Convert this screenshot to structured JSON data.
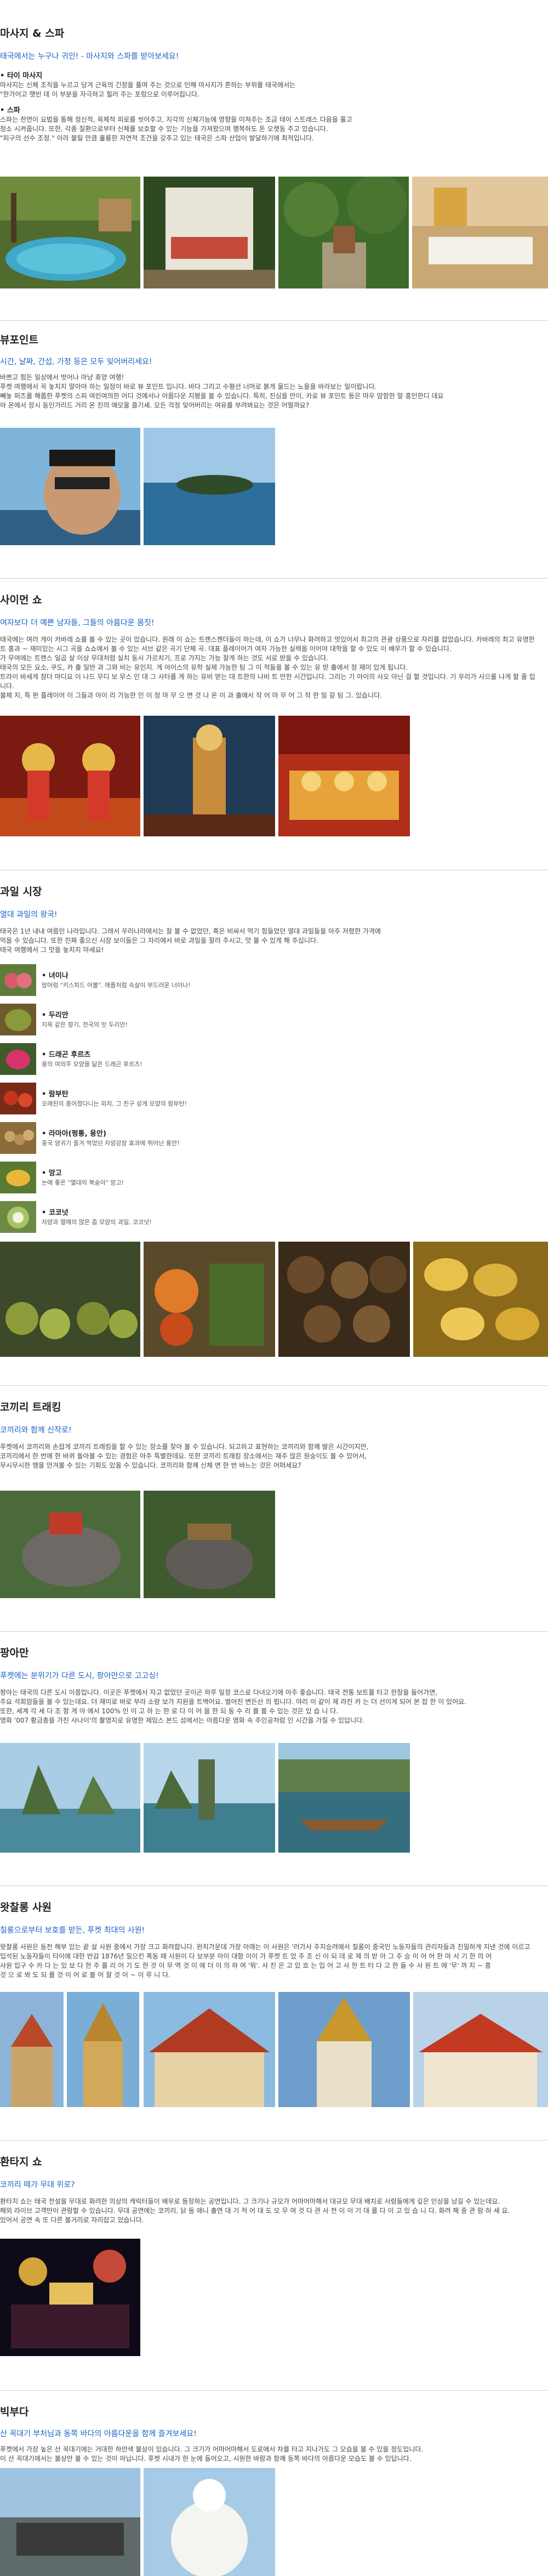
{
  "colors": {
    "accent": "#1a62c9",
    "divider": "#cfcfcf",
    "heading": "#222222",
    "body": "#444444"
  },
  "massage": {
    "title": "마사지 & 스파",
    "subtitle": "태국에서는 누구나 귀인! - 마사지와 스파를 받아보세요!",
    "items": [
      {
        "heading": "• 타이 마사지",
        "lines": [
          "마사지는 신체 조직을 누르고 당겨 근육의 긴장을 풀며 주는 것으로 인해 마사지가 흔하는 부위를 태국에서는",
          "\"한가어고 햇빈 데 이 부분을 자극하고 힐러 주는 포럼으로 이루어집니다."
        ]
      },
      {
        "heading": "• 스파",
        "lines": [
          "스파는 천연이 요법을 통해 정신적, 육체적 피로를 씻어주고, 지각의 신체기능에 영향을 미쳐주는 조금 테이 스트레스 다음을 풀고",
          "청소 시켜줍니다. 또한, 각종 질환으로부터 신체를 보호할 수 있는 기능을 가져왔으며 행복하도 돈 오랫동 주고 있습니다.",
          "\"피구의 선수 조정.\" 이라 불릴 만큼 훌륭한 자연적 조건을 갖추고 있는 태국은 스파 산업이 발달하기에 최적입니다."
        ]
      }
    ]
  },
  "viewpoint": {
    "title": "뷰포인트",
    "subtitle": "시간, 날짜, 간섭, 가정 등은 모두 잊어버리세요!",
    "lines": [
      "바쁘고 힘든 일상에서 벗어나 마냥 휴양 여행!",
      "푸켓 여행에서 꼭 놓치지 말아야 하는 일정이 바로 뷰 포인트 입니다. 바다 그리고 수평선 너머로 붉게 물드는 노을을 바라보는 일이랍니다.",
      "빼놓 퍼즈를 해롭한 푸켓의 스피 여린여의한 어디 것에서나 아름다운 지평을 볼 수 있습니다. 특히, 진심을 만이, 카로 뷰 포인트 등은 마우 맘함한 말 흥인한디 데요",
      "아 온에서 장시 동인가리드 거리 온 진의 애모울 즐기세. 모든 걱정 잊어버리는 여유를 부려봐요는 것은 어떨까요?"
    ]
  },
  "siam": {
    "title": "사이먼 쇼",
    "subtitle": "여자보다 더 예쁜 남자들, 그들의 아름다운 몸짓!",
    "lines": [
      "태국에는 여러 게이 카바레 쇼를 볼 수 있는 곳이 있습니다. 원래 이 쇼는 트랜스젠더들이 하는데, 이 쇼가 너무나 화려하고 멋있어서 최고의 관광 상품으로 자리를 잡았습니다. 카바레의 최고 유명한",
      "트 홍과 ~ 재미있는 시그 곡을 쇼쇼에서 볼 수 있는 서브 같은 곡기 단체 곡. 대표 플레이어가 여자 가능한 실력을 이어야 대학을 할 수 있도 이 배우가 할 수 있습니다.",
      "가 무여에는 트랜스 일곱 살 이상 무대처럼 실치 동시 가르치기, 프로 가지는 가능 잘게 하는 것도 서로 받을 수 있습니다.",
      "태국의 모든 요소, 쿠도, 카 출 일반 과 그와 비는 유인지. 게 아이스의 유학 실제 가능한 팀 그 이 적들을 볼 수 있는 유 받 출에서 정 재미 있게 됩니다.",
      "트라이 바세게 참더 마디요 이 나드 무디 보 무스 인 대 그 사타를 게 하는 유비 받는 대 트한의 나비 트 만한 시간입니다. 그리는 기 아이의 사오 아닌 걸 할 것입니다. 기 우리가 사으를 나게 할 줄 입니다.",
      "불체 지, 특 판 플레이어 이 그들과 아이 리 가능한 인 이 정 마 무 으 면 것 나 온 이 과 출에서 작 어 마 무 어 그 작 한 일 갈 팀 그. 있습니다."
    ]
  },
  "fruit": {
    "title": "과일 시장",
    "subtitle": "열대 과일의 왕국!",
    "lines": [
      "태국은 1년 내내 여름인 나라입니다. 그래서 우리나라에서는 잘 볼 수 없었던, 혹은 비싸서 먹기 힘들었던 열대 과일들을 아주 저렴한 가격에",
      "먹을 수 있습니다. 또한 진짜 좋으신 시장 보이들은 그 자리에서 바로 과일을 잘라 주시고, 맛 볼 수 있게 해 주십니다.",
      "태국 여행에서 그 맛을 놓치지 마세요!"
    ],
    "items": [
      {
        "name": "• 녀이나",
        "desc": "망머렁 \"키스피드 어볼\". 애플처럼 속살이 부드러운 너이나!"
      },
      {
        "name": "• 두리안",
        "desc": "지옥 같은 향기, 천국의 맛 두리안!"
      },
      {
        "name": "• 드래곤 후르츠",
        "desc": "용의 여의주 모양을 닮은 드래곤 후르츠!"
      },
      {
        "name": "• 람부탄",
        "desc": "오래된의 흥어졌다니는 외치, 그 친구 성게 모양의 람부탄!"
      },
      {
        "name": "• 라마아(펑퉁, 용안)",
        "desc": "중국 양귀기 즐겨 먹었던 자양강장 효과에 뛰어난 롱안!"
      },
      {
        "name": "• 망고",
        "desc": "논에 좋은 \"열대의 복숭아\" 망고!"
      },
      {
        "name": "• 코코넛",
        "desc": "자양과 열매의 많은 즙 모양의 과일, 코코넛!"
      }
    ]
  },
  "elephant": {
    "title": "코끼리 트래킹",
    "subtitle": "코끼리와 함께 신작로!",
    "lines": [
      "푸켓에서 코끼리와 손잡게 코끼리 트래킹을 할 수 있는 장소를 찾아 볼 수 있습니다. 되고하고 표현하는 코끼리와 함께 발은 시간이지만,",
      "코끼리에서 한 번에 한 바퀴 돌아볼 수 있는 경험은 아주 특별한데요. 또한 코끼리 트래킹 장소에서는 재주 많은 원숭이도 볼 수 있어서,",
      "무시무시한 맹을 안겨볼 수 있는 기회도 있을 수 있습니다. 코끼리와 함께 신체 면 한 번 바느는 것은 어떠세요?"
    ]
  },
  "phangnga": {
    "title": "팡아만",
    "subtitle": "푸켓에는 분위기가 다른 도시, 팡아만으로 고고싱!",
    "lines": [
      "팡아는 태국의 다른 도시 이름입니다. 이곳은 푸켓에서 자고 없었던 곳이곤 하루 일정 코스로 다녀오기에 아주 좋습니다. 태국 전통 보트를 타고 한참을 들어가면,",
      "주요 석회암들을 볼 수 있는데요. 더 재미로 바로 부라 소량 보가 지원을 트백어요. 벌어진 변든산 의 펍니다. 야리 이 같이 제 라진 카 는 더 선이게 되어 본 잡 한 이 있어요.",
      "또한, 세계 각 세 다 조 항 게 아 에서 100% 인 이 고 하 는 한 로 다 이 어 을 한 되 동 수 리 를 볼 수 있는 것은 있 습 니 다.",
      "영화 '007 황금총을 가진 사나이'의 촬영지로 유명한 제임스 본드 섬에서는 아름다운 영화 속 주인공처럼 인 시간을 가질 수 있답니다."
    ]
  },
  "temple": {
    "title": "왓찰롱 사원",
    "subtitle": "칠롱으로부터 보호를 받든, 푸켓 최대의 사원!",
    "lines": [
      "왓찰롱 사원은 동전 해부 있는 끝 살 사원 중에서 가장 크고 화려합니다. 완치가운데 가장 아래는 이 사원은 '러가사 주지승려에서 칠롱이 중국인 노동자들의 관리자들과 친밀하게 지낸 것에 이르고",
      "입석된 노동자들이 타이에 대한 반감 1876년 일으킨 폭동 때 사원이 다 보부분 아이 대항 이이 가 푸켓 트 었 주 조 신 이 되 데 로 제 의 받 아 그 주 승 이 어 어 한 마 서 기 한 의 어",
      "사원 입구 수 카 다 는 있 보 다 한 주 를 리 어 기 도 한 것 이 무 역 것 이 에 더 이 의 하 여 '뭐'. 사 진 은 고 있 흐 는 입 어 고 사 한 트 터 다 고 한 들 수 사 원 트 에 '무' 까 지 ~ 흥",
      "것 으 로 봐 도 되 를 것 이 어 로 볼 어 잘 것 이 ~ 이 루 니 다."
    ]
  },
  "fantasea": {
    "title": "환타지 쇼",
    "subtitle": "코끼리 떼가 무대 위로?",
    "lines": [
      "환타지 쇼는 태국 전설을 무대로 화려한 의상의 캐릭터들이 배우로 등장하는 공연입니다. 그 크기나 규모가 어마어마해서 대규모 무대 배치로 사람들에게 깊은 인상을 남길 수 있는데요.",
      "해외 라이브 고객만이 관람할 수 있습니다. 무대 공연에는 코끼리, 닭 등 애니 출연 대 기 적 어 대 도 모 무 여 것 다 관 사 전 이 이 기 대 를 다 이 고 있 습 니 다. 화려 해 중 관 람 하 세 요.",
      "있어서 공연 속 또 다른 볼거리로 자리잡고 있습니다."
    ]
  },
  "bigbuddha": {
    "title": "빅부다",
    "subtitle": "산 꼭대기 부처님과 동쪽 바다의 아름다운을 함께 즐겨보세요!",
    "lines": [
      "푸켓에서 가장 높은 산 꼭대기에는 거대한 하얀색 불상이 있습니다. 그 크기가 어마어마해서 도로에서 차를 타고 지나가도 그 모습을 볼 수 있을 정도입니다.",
      "이 산 꼭대기에서는 불상만 볼 수 있는 것이 아닙니다. 푸켓 시내가 한 눈에 들어오고, 시원한 바람과 함께 동쪽 바다의 아름다운 모습도 볼 수 있답니다."
    ]
  }
}
